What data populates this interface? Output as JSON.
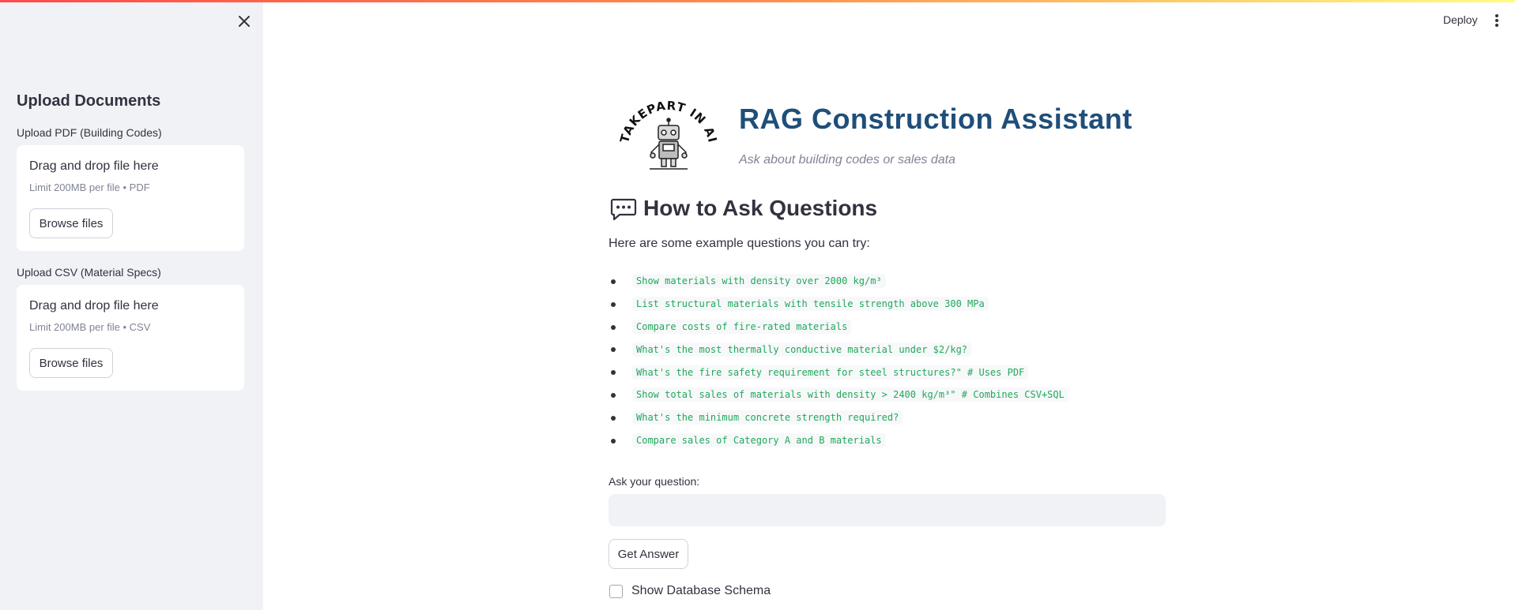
{
  "sidebar": {
    "heading": "Upload Documents",
    "uploaders": [
      {
        "label": "Upload PDF (Building Codes)",
        "drop_text": "Drag and drop file here",
        "limit_text": "Limit 200MB per file • PDF",
        "button_label": "Browse files"
      },
      {
        "label": "Upload CSV (Material Specs)",
        "drop_text": "Drag and drop file here",
        "limit_text": "Limit 200MB per file • CSV",
        "button_label": "Browse files"
      }
    ]
  },
  "toolbar": {
    "deploy_label": "Deploy"
  },
  "header": {
    "logo_text": "TAKEPART IN AI",
    "title": "RAG Construction Assistant",
    "subtitle": "Ask about building codes or sales data"
  },
  "guide": {
    "title": "How to Ask Questions",
    "intro": "Here are some example questions you can try:",
    "examples": [
      "Show materials with density over 2000 kg/m³",
      "List structural materials with tensile strength above 300 MPa",
      "Compare costs of fire-rated materials",
      "What's the most thermally conductive material under $2/kg?",
      "What's the fire safety requirement for steel structures?\" # Uses PDF",
      "Show total sales of materials with density > 2400 kg/m³\" # Combines CSV+SQL",
      "What's the minimum concrete strength required?",
      "Compare sales of Category A and B materials"
    ]
  },
  "query": {
    "label": "Ask your question:",
    "value": "",
    "placeholder": "",
    "button_label": "Get Answer",
    "schema_checkbox_label": "Show Database Schema",
    "schema_checked": false
  },
  "colors": {
    "title": "#1f4e79",
    "code_text": "#21a85a",
    "sidebar_bg": "#f0f2f6"
  }
}
